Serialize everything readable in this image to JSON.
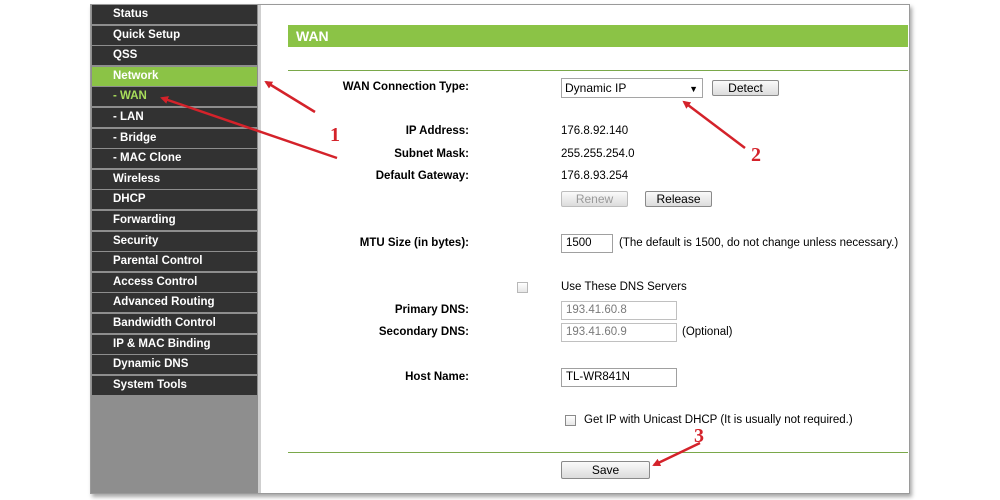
{
  "sidebar": {
    "items": [
      {
        "label": "Status"
      },
      {
        "label": "Quick Setup"
      },
      {
        "label": "QSS"
      },
      {
        "label": "Network"
      },
      {
        "label": "- WAN"
      },
      {
        "label": "- LAN"
      },
      {
        "label": "- Bridge"
      },
      {
        "label": "- MAC Clone"
      },
      {
        "label": "Wireless"
      },
      {
        "label": "DHCP"
      },
      {
        "label": "Forwarding"
      },
      {
        "label": "Security"
      },
      {
        "label": "Parental Control"
      },
      {
        "label": "Access Control"
      },
      {
        "label": "Advanced Routing"
      },
      {
        "label": "Bandwidth Control"
      },
      {
        "label": "IP & MAC Binding"
      },
      {
        "label": "Dynamic DNS"
      },
      {
        "label": "System Tools"
      }
    ]
  },
  "page": {
    "title": "WAN",
    "wan_type_label": "WAN Connection Type:",
    "wan_type_value": "Dynamic IP",
    "detect_label": "Detect",
    "ip_label": "IP Address:",
    "ip_value": "176.8.92.140",
    "mask_label": "Subnet Mask:",
    "mask_value": "255.255.254.0",
    "gateway_label": "Default Gateway:",
    "gateway_value": "176.8.93.254",
    "renew_label": "Renew",
    "release_label": "Release",
    "mtu_label": "MTU Size (in bytes):",
    "mtu_value": "1500",
    "mtu_note": "(The default is 1500, do not change unless necessary.)",
    "use_dns_label": "Use These DNS Servers",
    "primary_dns_label": "Primary DNS:",
    "primary_dns_value": "193.41.60.8",
    "secondary_dns_label": "Secondary DNS:",
    "secondary_dns_value": "193.41.60.9",
    "optional_note": "(Optional)",
    "host_label": "Host Name:",
    "host_value": "TL-WR841N",
    "unicast_label": "Get IP with Unicast DHCP (It is usually not required.)",
    "save_label": "Save"
  },
  "annotations": {
    "one": "1",
    "two": "2",
    "three": "3"
  },
  "colors": {
    "accent": "#8bc346",
    "sidebar_item": "#323232",
    "annotation": "#d4222a"
  }
}
